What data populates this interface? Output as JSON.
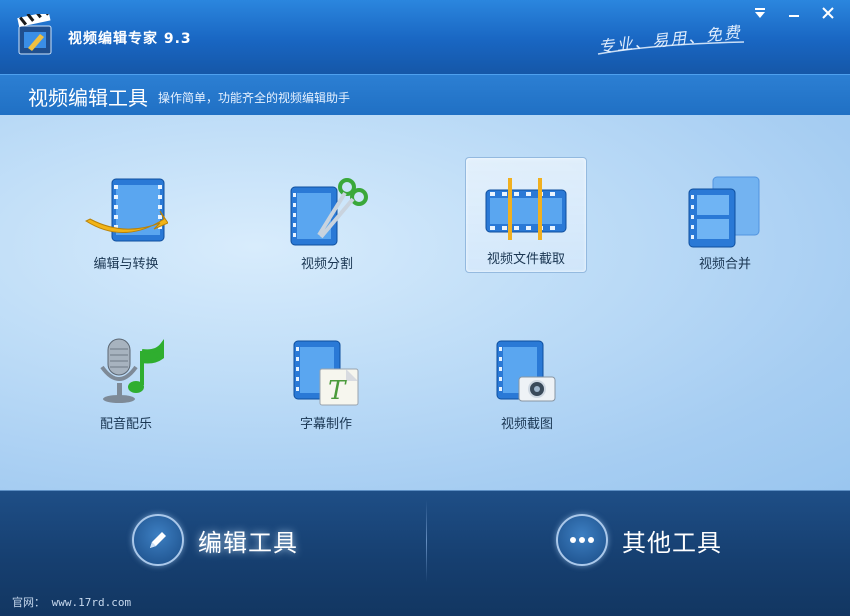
{
  "app": {
    "title": "视频编辑专家 9.3",
    "slogan": "专业、易用、免费"
  },
  "window_controls": [
    {
      "name": "menu",
      "glyph": "▾"
    },
    {
      "name": "minimize",
      "glyph": "—"
    },
    {
      "name": "close",
      "glyph": "✕"
    }
  ],
  "section": {
    "title": "视频编辑工具",
    "subtitle": "操作简单，功能齐全的视频编辑助手"
  },
  "tools": [
    {
      "label": "编辑与转换",
      "icon": "film-convert-icon",
      "selected": false
    },
    {
      "label": "视频分割",
      "icon": "film-scissors-icon",
      "selected": false
    },
    {
      "label": "视频文件截取",
      "icon": "film-clip-icon",
      "selected": true
    },
    {
      "label": "视频合并",
      "icon": "film-merge-icon",
      "selected": false
    },
    {
      "label": "配音配乐",
      "icon": "microphone-music-icon",
      "selected": false
    },
    {
      "label": "字幕制作",
      "icon": "film-subtitle-icon",
      "selected": false
    },
    {
      "label": "视频截图",
      "icon": "film-camera-icon",
      "selected": false
    }
  ],
  "footer": {
    "edit_tools": "编辑工具",
    "other_tools": "其他工具",
    "website": "官网： www.17rd.com"
  },
  "colors": {
    "titlebar": "#1966c2",
    "content_bg": "#bddcf7",
    "footer_bg": "#163f70",
    "film_blue": "#1f6fcf"
  }
}
